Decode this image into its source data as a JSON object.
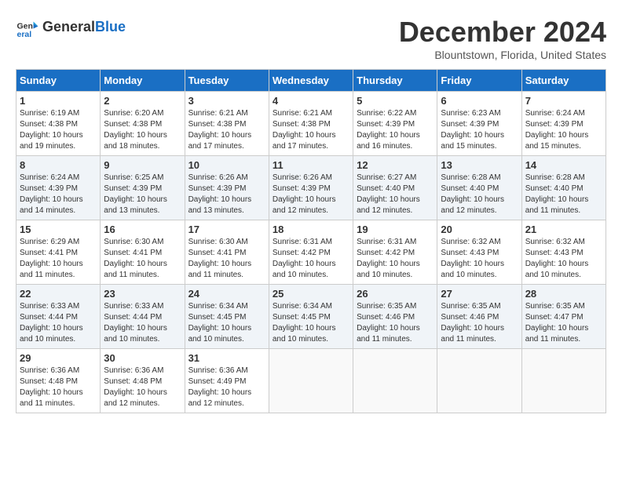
{
  "header": {
    "logo_line1": "General",
    "logo_line2": "Blue",
    "month_title": "December 2024",
    "location": "Blountstown, Florida, United States"
  },
  "weekdays": [
    "Sunday",
    "Monday",
    "Tuesday",
    "Wednesday",
    "Thursday",
    "Friday",
    "Saturday"
  ],
  "weeks": [
    [
      {
        "day": "1",
        "sunrise": "6:19 AM",
        "sunset": "4:38 PM",
        "daylight": "10 hours and 19 minutes."
      },
      {
        "day": "2",
        "sunrise": "6:20 AM",
        "sunset": "4:38 PM",
        "daylight": "10 hours and 18 minutes."
      },
      {
        "day": "3",
        "sunrise": "6:21 AM",
        "sunset": "4:38 PM",
        "daylight": "10 hours and 17 minutes."
      },
      {
        "day": "4",
        "sunrise": "6:21 AM",
        "sunset": "4:38 PM",
        "daylight": "10 hours and 17 minutes."
      },
      {
        "day": "5",
        "sunrise": "6:22 AM",
        "sunset": "4:39 PM",
        "daylight": "10 hours and 16 minutes."
      },
      {
        "day": "6",
        "sunrise": "6:23 AM",
        "sunset": "4:39 PM",
        "daylight": "10 hours and 15 minutes."
      },
      {
        "day": "7",
        "sunrise": "6:24 AM",
        "sunset": "4:39 PM",
        "daylight": "10 hours and 15 minutes."
      }
    ],
    [
      {
        "day": "8",
        "sunrise": "6:24 AM",
        "sunset": "4:39 PM",
        "daylight": "10 hours and 14 minutes."
      },
      {
        "day": "9",
        "sunrise": "6:25 AM",
        "sunset": "4:39 PM",
        "daylight": "10 hours and 13 minutes."
      },
      {
        "day": "10",
        "sunrise": "6:26 AM",
        "sunset": "4:39 PM",
        "daylight": "10 hours and 13 minutes."
      },
      {
        "day": "11",
        "sunrise": "6:26 AM",
        "sunset": "4:39 PM",
        "daylight": "10 hours and 12 minutes."
      },
      {
        "day": "12",
        "sunrise": "6:27 AM",
        "sunset": "4:40 PM",
        "daylight": "10 hours and 12 minutes."
      },
      {
        "day": "13",
        "sunrise": "6:28 AM",
        "sunset": "4:40 PM",
        "daylight": "10 hours and 12 minutes."
      },
      {
        "day": "14",
        "sunrise": "6:28 AM",
        "sunset": "4:40 PM",
        "daylight": "10 hours and 11 minutes."
      }
    ],
    [
      {
        "day": "15",
        "sunrise": "6:29 AM",
        "sunset": "4:41 PM",
        "daylight": "10 hours and 11 minutes."
      },
      {
        "day": "16",
        "sunrise": "6:30 AM",
        "sunset": "4:41 PM",
        "daylight": "10 hours and 11 minutes."
      },
      {
        "day": "17",
        "sunrise": "6:30 AM",
        "sunset": "4:41 PM",
        "daylight": "10 hours and 11 minutes."
      },
      {
        "day": "18",
        "sunrise": "6:31 AM",
        "sunset": "4:42 PM",
        "daylight": "10 hours and 10 minutes."
      },
      {
        "day": "19",
        "sunrise": "6:31 AM",
        "sunset": "4:42 PM",
        "daylight": "10 hours and 10 minutes."
      },
      {
        "day": "20",
        "sunrise": "6:32 AM",
        "sunset": "4:43 PM",
        "daylight": "10 hours and 10 minutes."
      },
      {
        "day": "21",
        "sunrise": "6:32 AM",
        "sunset": "4:43 PM",
        "daylight": "10 hours and 10 minutes."
      }
    ],
    [
      {
        "day": "22",
        "sunrise": "6:33 AM",
        "sunset": "4:44 PM",
        "daylight": "10 hours and 10 minutes."
      },
      {
        "day": "23",
        "sunrise": "6:33 AM",
        "sunset": "4:44 PM",
        "daylight": "10 hours and 10 minutes."
      },
      {
        "day": "24",
        "sunrise": "6:34 AM",
        "sunset": "4:45 PM",
        "daylight": "10 hours and 10 minutes."
      },
      {
        "day": "25",
        "sunrise": "6:34 AM",
        "sunset": "4:45 PM",
        "daylight": "10 hours and 10 minutes."
      },
      {
        "day": "26",
        "sunrise": "6:35 AM",
        "sunset": "4:46 PM",
        "daylight": "10 hours and 11 minutes."
      },
      {
        "day": "27",
        "sunrise": "6:35 AM",
        "sunset": "4:46 PM",
        "daylight": "10 hours and 11 minutes."
      },
      {
        "day": "28",
        "sunrise": "6:35 AM",
        "sunset": "4:47 PM",
        "daylight": "10 hours and 11 minutes."
      }
    ],
    [
      {
        "day": "29",
        "sunrise": "6:36 AM",
        "sunset": "4:48 PM",
        "daylight": "10 hours and 11 minutes."
      },
      {
        "day": "30",
        "sunrise": "6:36 AM",
        "sunset": "4:48 PM",
        "daylight": "10 hours and 12 minutes."
      },
      {
        "day": "31",
        "sunrise": "6:36 AM",
        "sunset": "4:49 PM",
        "daylight": "10 hours and 12 minutes."
      },
      null,
      null,
      null,
      null
    ]
  ]
}
